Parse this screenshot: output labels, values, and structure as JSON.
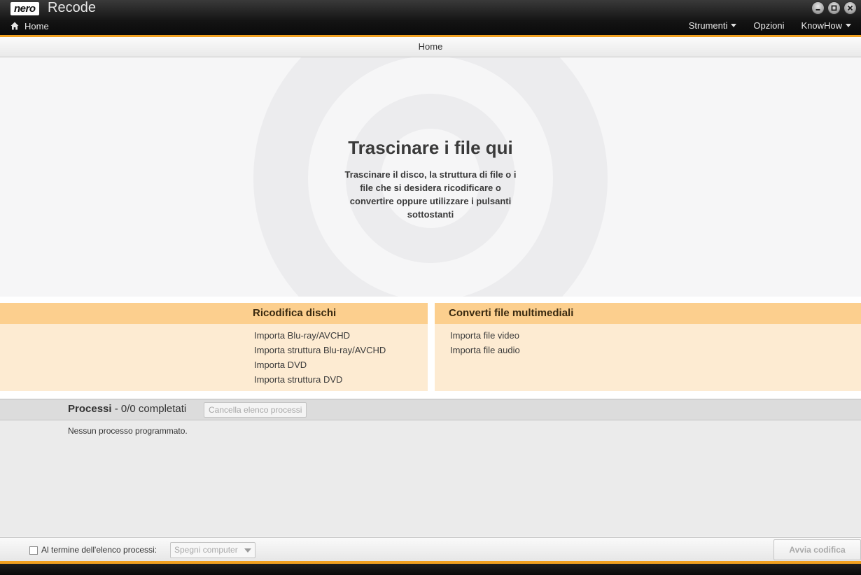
{
  "app": {
    "logo_text": "nero",
    "title": "Recode",
    "home_label": "Home",
    "menu": {
      "tools": "Strumenti",
      "options": "Opzioni",
      "knowhow": "KnowHow"
    }
  },
  "breadcrumb": "Home",
  "dropzone": {
    "title": "Trascinare i file qui",
    "subtitle": "Trascinare il disco, la struttura di file o i file che si desidera ricodificare o convertire oppure utilizzare i pulsanti sottostanti"
  },
  "recode_discs": {
    "title": "Ricodifica dischi",
    "items": [
      "Importa Blu-ray/AVCHD",
      "Importa struttura Blu-ray/AVCHD",
      "Importa DVD",
      "Importa struttura DVD"
    ]
  },
  "convert_media": {
    "title": "Converti file multimediali",
    "items": [
      "Importa file video",
      "Importa file audio"
    ]
  },
  "processes": {
    "title": "Processi",
    "status": " - 0/0 completati",
    "clear_button": "Cancella elenco processi",
    "empty_text": "Nessun processo programmato."
  },
  "footer": {
    "checkbox_label": "Al termine dell'elenco processi:",
    "select_value": "Spegni computer",
    "start_button": "Avvia codifica"
  },
  "colors": {
    "accent_orange": "#f0a020",
    "panel_header": "#fccf8e",
    "panel_body": "#fdebd2"
  }
}
